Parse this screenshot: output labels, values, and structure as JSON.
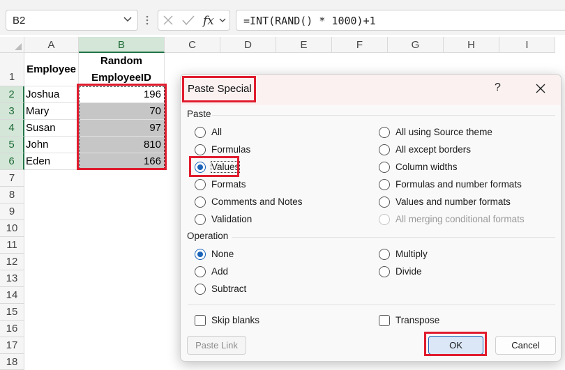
{
  "namebox": {
    "value": "B2"
  },
  "formula_bar": {
    "formula": "=INT(RAND() * 1000)+1"
  },
  "columns": [
    "A",
    "B",
    "C",
    "D",
    "E",
    "F",
    "G",
    "H",
    "I"
  ],
  "rows": [
    "1",
    "2",
    "3",
    "4",
    "5",
    "6",
    "7",
    "8",
    "9",
    "10",
    "11",
    "12",
    "13",
    "14",
    "15",
    "16",
    "17",
    "18"
  ],
  "sheet": {
    "header_a": "Employee",
    "header_b_line1": "Random",
    "header_b_line2": "EmployeeID",
    "data": [
      {
        "name": "Joshua",
        "id": "196"
      },
      {
        "name": "Mary",
        "id": "70"
      },
      {
        "name": "Susan",
        "id": "97"
      },
      {
        "name": "John",
        "id": "810"
      },
      {
        "name": "Eden",
        "id": "166"
      }
    ]
  },
  "dialog": {
    "title": "Paste Special",
    "help": "?",
    "paste_section": "Paste",
    "paste_left": [
      "All",
      "Formulas",
      "Values",
      "Formats",
      "Comments and Notes",
      "Validation"
    ],
    "paste_right": [
      "All using Source theme",
      "All except borders",
      "Column widths",
      "Formulas and number formats",
      "Values and number formats",
      "All merging conditional formats"
    ],
    "paste_selected": "Values",
    "operation_section": "Operation",
    "operation_left": [
      "None",
      "Add",
      "Subtract"
    ],
    "operation_right": [
      "Multiply",
      "Divide"
    ],
    "operation_selected": "None",
    "skip_blanks": "Skip blanks",
    "transpose": "Transpose",
    "paste_link": "Paste Link",
    "ok": "OK",
    "cancel": "Cancel"
  },
  "colors": {
    "highlight": "#e01c2e",
    "accent": "#1a63b8",
    "excel_green": "#217346"
  }
}
